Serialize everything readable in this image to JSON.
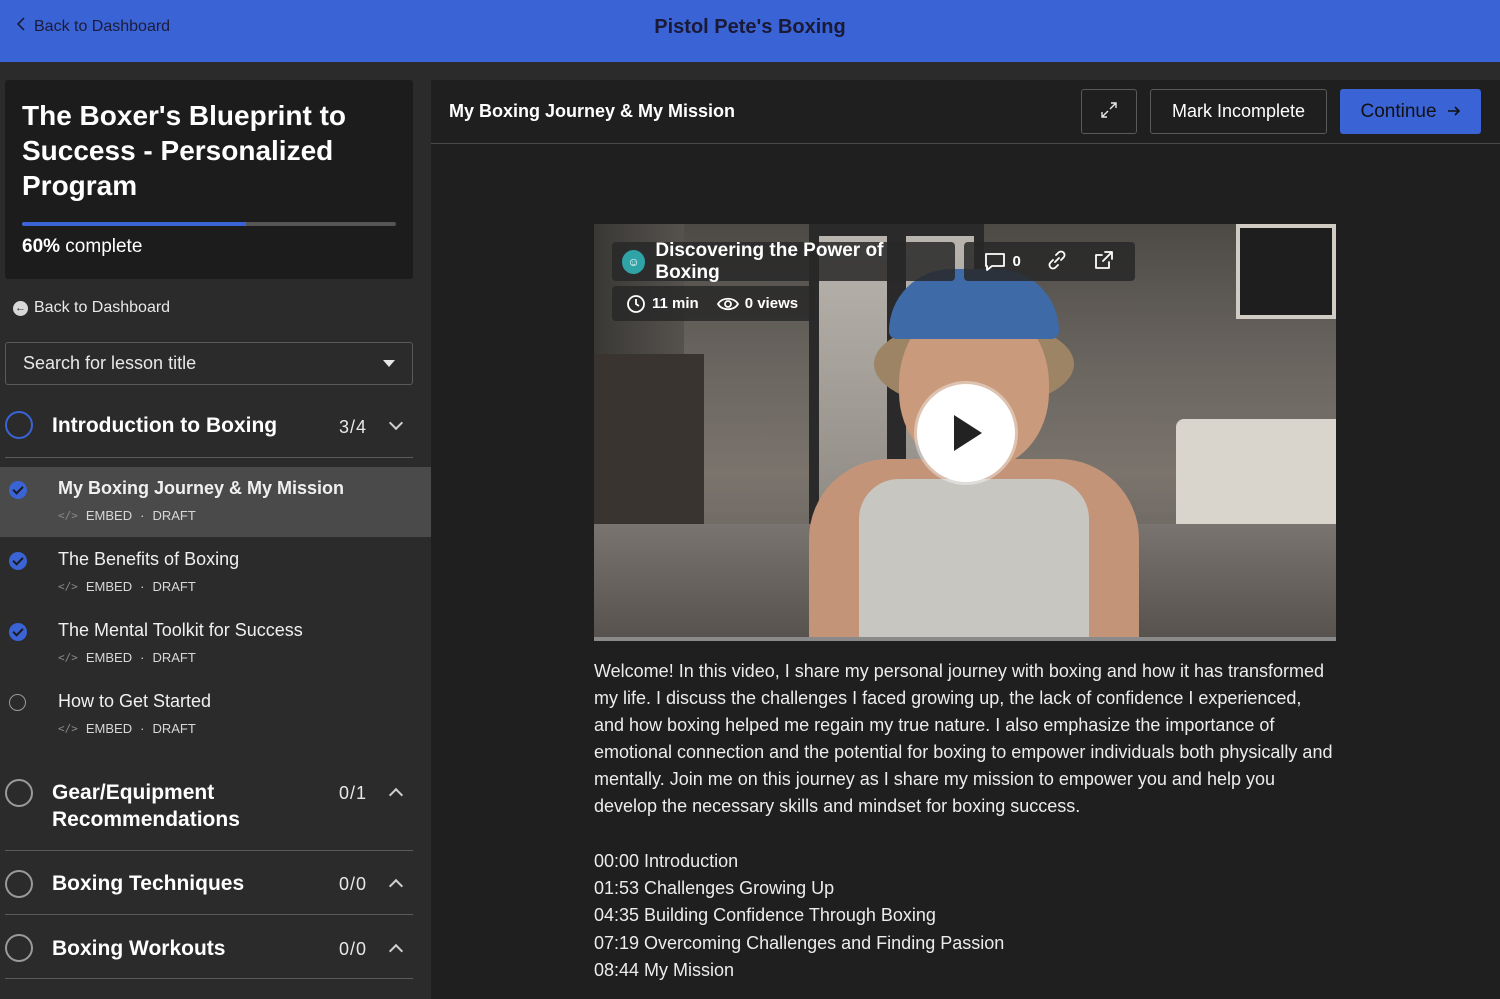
{
  "topbar": {
    "back_label": "Back to Dashboard",
    "title": "Pistol Pete's Boxing"
  },
  "course": {
    "title": "The Boxer's Blueprint to Success - Personalized Program",
    "progress_percent": 60,
    "progress_pct_label": "60%",
    "progress_suffix": " complete"
  },
  "sidebar": {
    "back_label": "Back to Dashboard",
    "search_placeholder": "Search for lesson title",
    "sections": [
      {
        "name": "Introduction to Boxing",
        "count": "3/4",
        "expanded": true,
        "lessons": [
          {
            "name": "My Boxing Journey & My Mission",
            "type": "EMBED",
            "status": "DRAFT",
            "done": true,
            "current": true
          },
          {
            "name": "The Benefits of Boxing",
            "type": "EMBED",
            "status": "DRAFT",
            "done": true,
            "current": false
          },
          {
            "name": "The Mental Toolkit for Success",
            "type": "EMBED",
            "status": "DRAFT",
            "done": true,
            "current": false
          },
          {
            "name": "How to Get Started",
            "type": "EMBED",
            "status": "DRAFT",
            "done": false,
            "current": false
          }
        ]
      },
      {
        "name": "Gear/Equipment Recommendations",
        "count": "0/1",
        "expanded": false
      },
      {
        "name": "Boxing Techniques",
        "count": "0/0",
        "expanded": false
      },
      {
        "name": "Boxing Workouts",
        "count": "0/0",
        "expanded": false
      }
    ]
  },
  "main": {
    "lesson_title": "My Boxing Journey & My Mission",
    "mark_label": "Mark Incomplete",
    "continue_label": "Continue",
    "video": {
      "title": "Discovering the Power of Boxing",
      "comments": "0",
      "duration": "11 min",
      "views": "0 views"
    },
    "description": "Welcome! In this video, I share my personal journey with boxing and how it has transformed my life. I discuss the challenges I faced growing up, the lack of confidence I experienced, and how boxing helped me regain my true nature. I also emphasize the importance of emotional connection and the potential for boxing to empower individuals both physically and mentally. Join me on this journey as I share my mission to empower you and help you develop the necessary skills and mindset for boxing success.",
    "chapters": [
      "00:00 Introduction",
      "01:53 Challenges Growing Up",
      "04:35 Building Confidence Through Boxing",
      "07:19 Overcoming Challenges and Finding Passion",
      "08:44 My Mission"
    ]
  },
  "colors": {
    "accent": "#3a63d6",
    "sidebar_bg": "#2b2b2b",
    "main_bg": "#1f1f1f"
  }
}
